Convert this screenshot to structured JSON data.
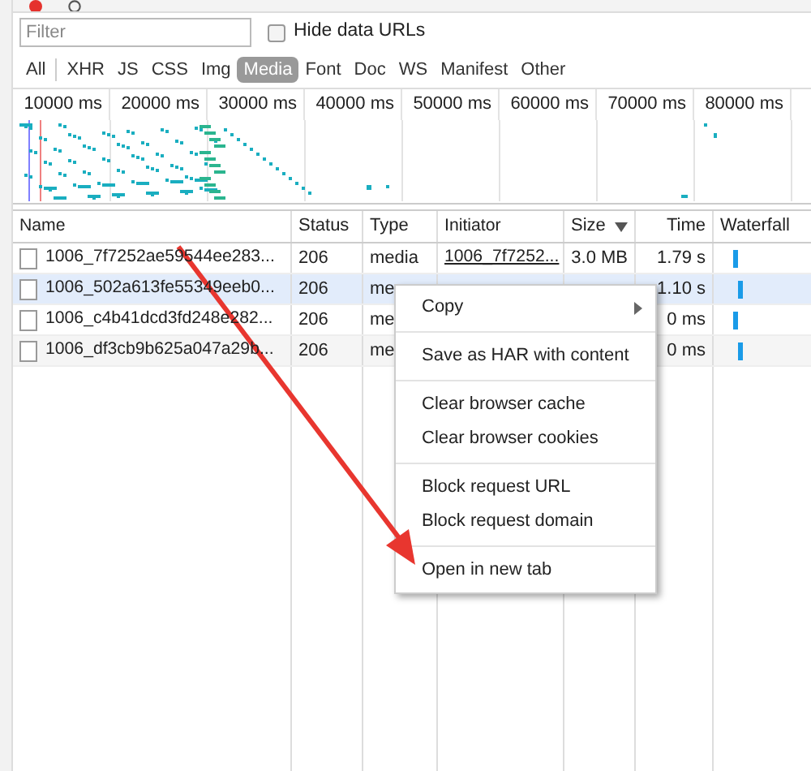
{
  "filter_bar": {
    "placeholder": "Filter",
    "hide_data_urls": {
      "label": "Hide data URLs",
      "checked": false
    }
  },
  "type_filters": [
    {
      "label": "All",
      "selected": false
    },
    {
      "label": "XHR",
      "selected": false
    },
    {
      "label": "JS",
      "selected": false
    },
    {
      "label": "CSS",
      "selected": false
    },
    {
      "label": "Img",
      "selected": false
    },
    {
      "label": "Media",
      "selected": true
    },
    {
      "label": "Font",
      "selected": false
    },
    {
      "label": "Doc",
      "selected": false
    },
    {
      "label": "WS",
      "selected": false
    },
    {
      "label": "Manifest",
      "selected": false
    },
    {
      "label": "Other",
      "selected": false
    }
  ],
  "overview": {
    "ticks": [
      "10000 ms",
      "20000 ms",
      "30000 ms",
      "40000 ms",
      "50000 ms",
      "60000 ms",
      "70000 ms",
      "80000 ms"
    ]
  },
  "table": {
    "columns": [
      {
        "label": "Name",
        "sorted": false
      },
      {
        "label": "Status",
        "sorted": false
      },
      {
        "label": "Type",
        "sorted": false
      },
      {
        "label": "Initiator",
        "sorted": false
      },
      {
        "label": "Size",
        "sorted": true
      },
      {
        "label": "Time",
        "sorted": false
      },
      {
        "label": "Waterfall",
        "sorted": false
      }
    ],
    "rows": [
      {
        "name": "1006_7f7252ae59544ee283...",
        "status": "206",
        "type": "media",
        "initiator": "1006_7f7252...",
        "size": "3.0 MB",
        "time": "1.79 s",
        "selected": false
      },
      {
        "name": "1006_502a613fe55349eeb0...",
        "status": "206",
        "type": "me",
        "time": "1.10 s",
        "selected": true
      },
      {
        "name": "1006_c4b41dcd3fd248e282...",
        "status": "206",
        "type": "me",
        "time": "0 ms",
        "selected": false
      },
      {
        "name": "1006_df3cb9b625a047a29b...",
        "status": "206",
        "type": "me",
        "time": "0 ms",
        "selected": false
      }
    ]
  },
  "context_menu": {
    "groups": [
      [
        {
          "label": "Copy",
          "submenu": true
        }
      ],
      [
        {
          "label": "Save as HAR with content",
          "submenu": false
        }
      ],
      [
        {
          "label": "Clear browser cache",
          "submenu": false
        },
        {
          "label": "Clear browser cookies",
          "submenu": false
        }
      ],
      [
        {
          "label": "Block request URL",
          "submenu": false
        },
        {
          "label": "Block request domain",
          "submenu": false
        }
      ],
      [
        {
          "label": "Open in new tab",
          "submenu": false
        }
      ]
    ]
  }
}
